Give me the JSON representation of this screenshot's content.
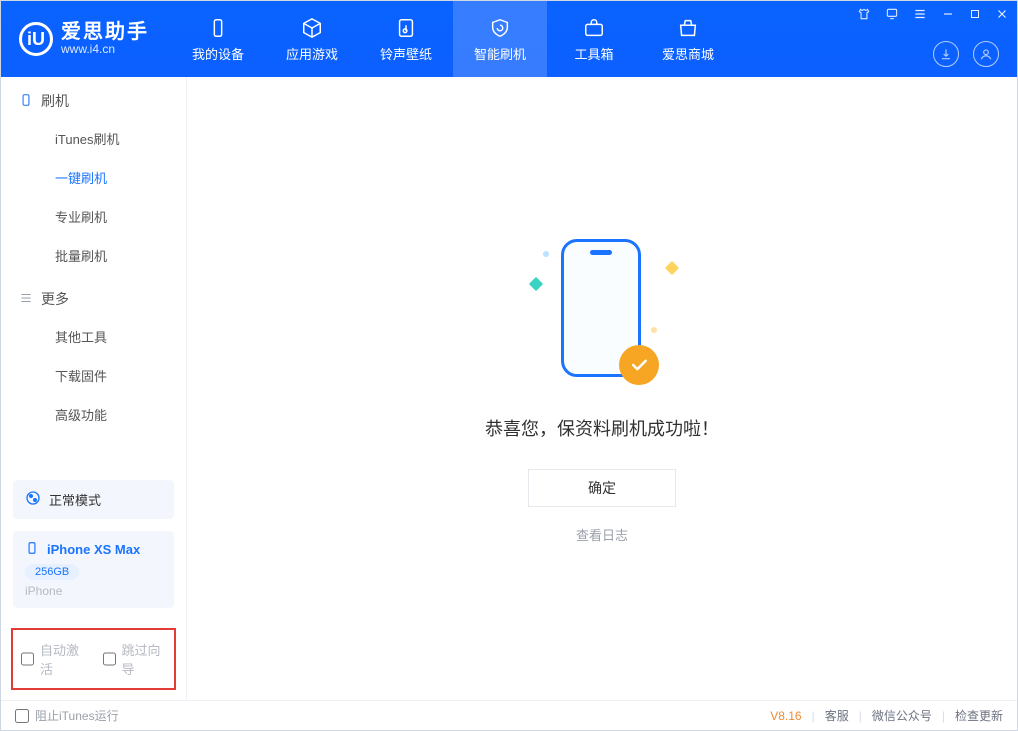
{
  "brand": {
    "title": "爱思助手",
    "subtitle": "www.i4.cn"
  },
  "nav": {
    "items": [
      {
        "label": "我的设备"
      },
      {
        "label": "应用游戏"
      },
      {
        "label": "铃声壁纸"
      },
      {
        "label": "智能刷机"
      },
      {
        "label": "工具箱"
      },
      {
        "label": "爱思商城"
      }
    ]
  },
  "sidebar": {
    "group1": {
      "title": "刷机",
      "items": [
        {
          "label": "iTunes刷机"
        },
        {
          "label": "一键刷机"
        },
        {
          "label": "专业刷机"
        },
        {
          "label": "批量刷机"
        }
      ]
    },
    "group2": {
      "title": "更多",
      "items": [
        {
          "label": "其他工具"
        },
        {
          "label": "下载固件"
        },
        {
          "label": "高级功能"
        }
      ]
    }
  },
  "device": {
    "mode_label": "正常模式",
    "name": "iPhone XS Max",
    "capacity": "256GB",
    "type": "iPhone"
  },
  "options": {
    "auto_activate": "自动激活",
    "skip_wizard": "跳过向导"
  },
  "main": {
    "success_text": "恭喜您，保资料刷机成功啦！",
    "ok_button": "确定",
    "view_log": "查看日志"
  },
  "statusbar": {
    "block_itunes": "阻止iTunes运行",
    "version": "V8.16",
    "support": "客服",
    "wechat": "微信公众号",
    "update": "检查更新"
  }
}
